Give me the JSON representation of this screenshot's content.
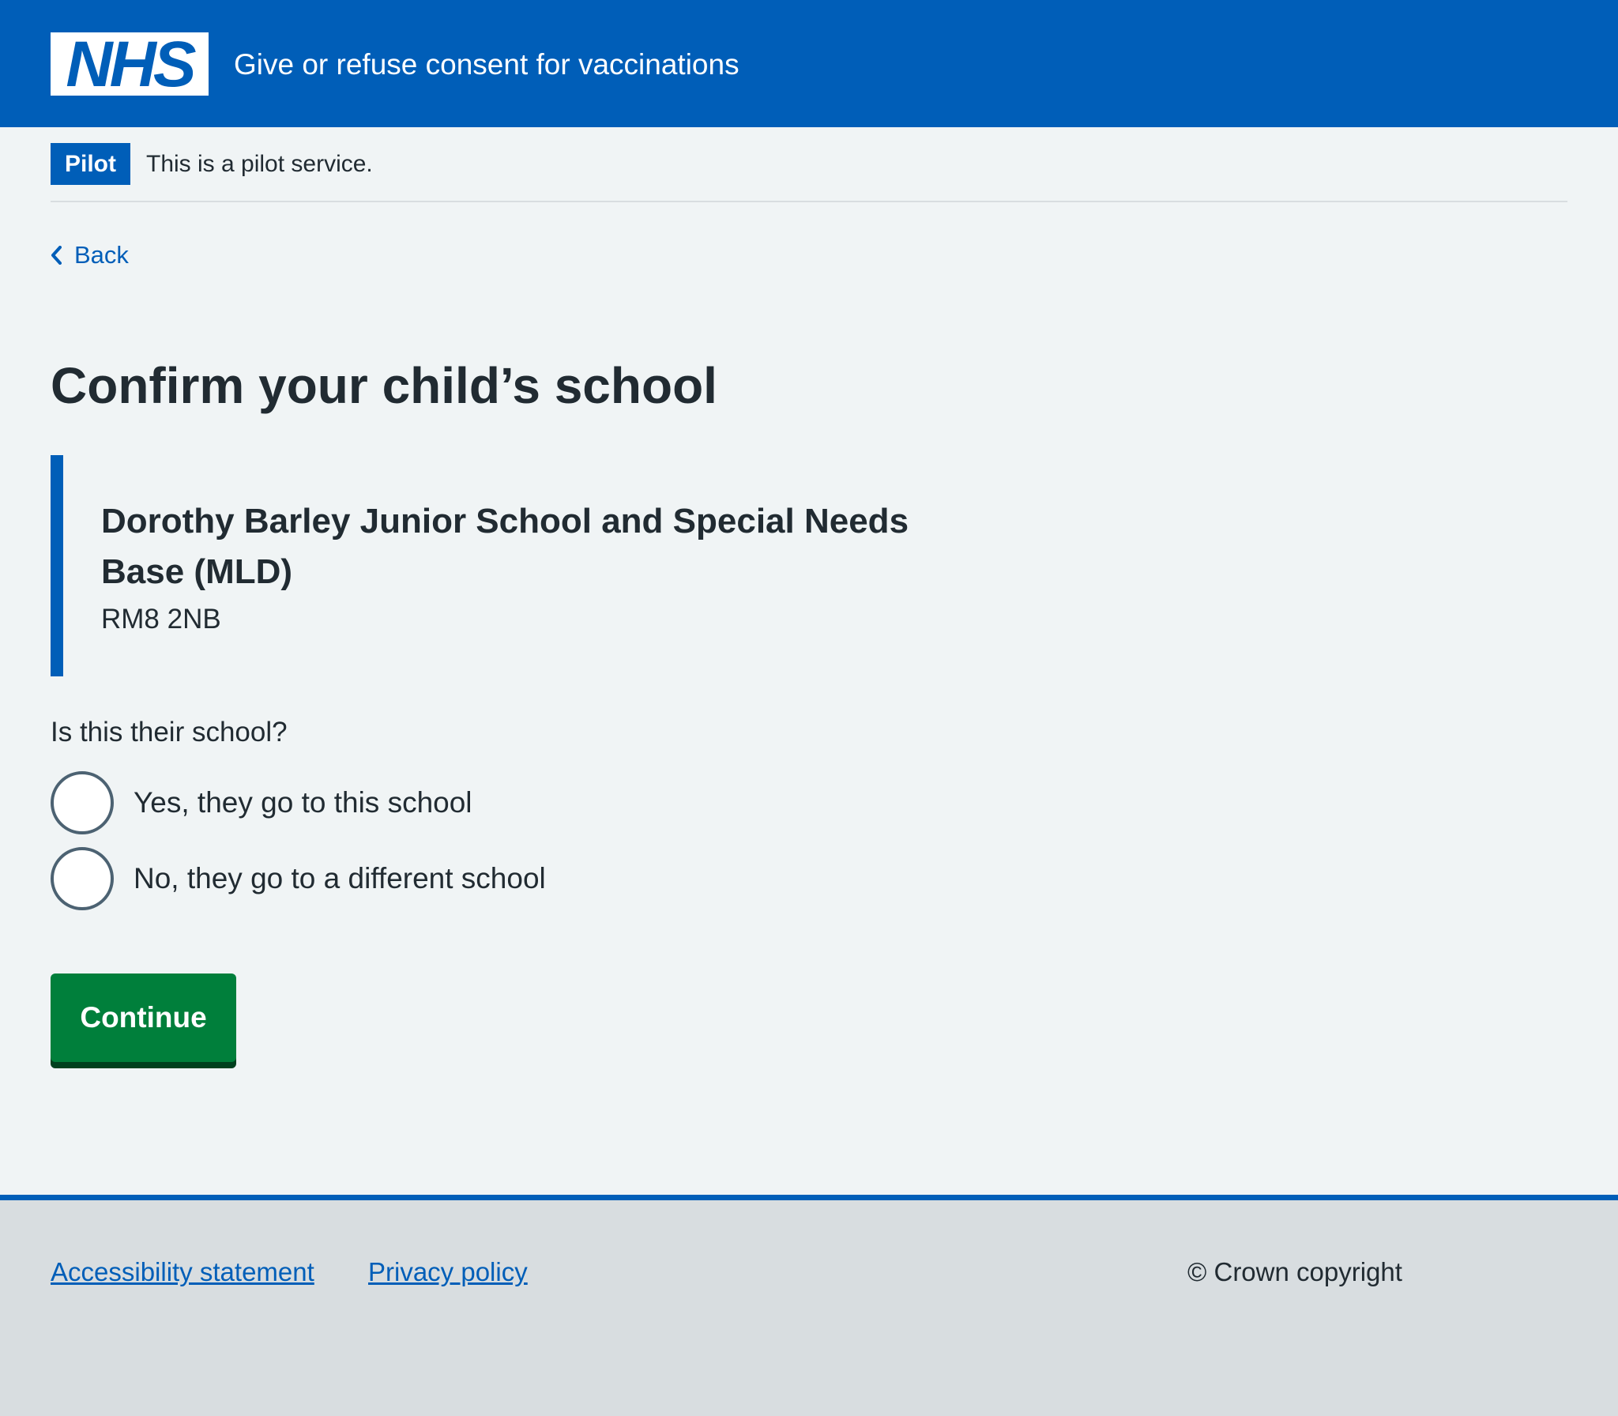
{
  "header": {
    "logo_text": "NHS",
    "service_name": "Give or refuse consent for vaccinations"
  },
  "phase_banner": {
    "tag": "Pilot",
    "text": "This is a pilot service."
  },
  "back_link": {
    "label": "Back",
    "icon": "chevron-left-icon"
  },
  "main": {
    "title": "Confirm your child’s school",
    "school": {
      "name": "Dorothy Barley Junior School and Special Needs Base (MLD)",
      "postcode": "RM8 2NB"
    },
    "question": "Is this their school?",
    "options": [
      {
        "label": "Yes, they go to this school",
        "selected": false
      },
      {
        "label": "No, they go to a different school",
        "selected": false
      }
    ],
    "continue_label": "Continue"
  },
  "footer": {
    "links": [
      "Accessibility statement",
      "Privacy policy"
    ],
    "copyright": "© Crown copyright"
  },
  "colors": {
    "nhs_blue": "#005eb8",
    "button_green": "#007f3b",
    "background": "#f0f4f5",
    "footer_background": "#d8dde0",
    "text": "#212b32"
  }
}
